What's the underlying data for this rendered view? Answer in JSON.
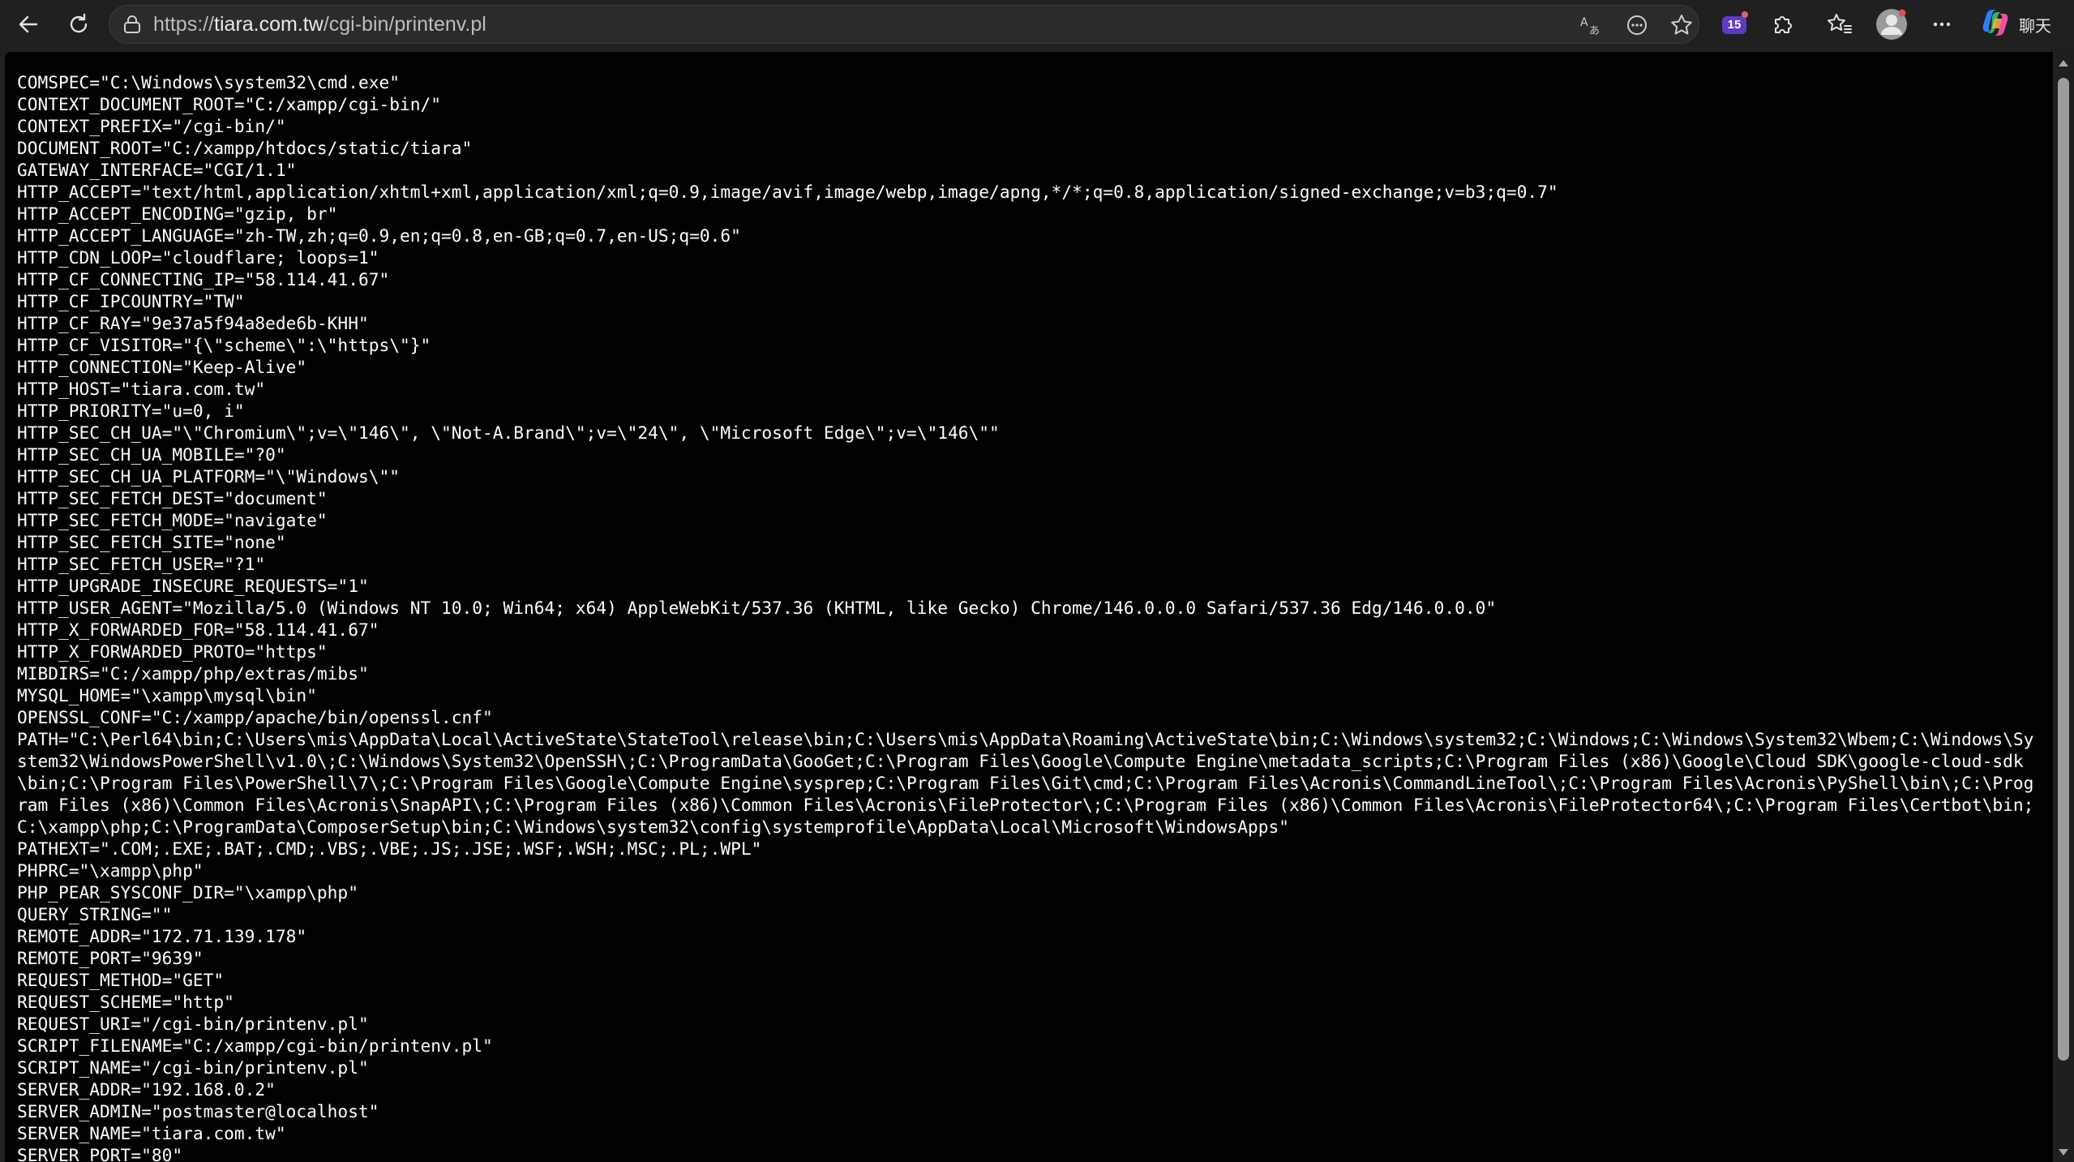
{
  "browser": {
    "url_scheme": "https://",
    "url_host": "tiara.com.tw",
    "url_path": "/cgi-bin/printenv.pl",
    "extensions_badge": "15",
    "copilot_label": "聊天",
    "icons": {
      "back": "arrow-left-icon",
      "reload": "reload-icon",
      "site_info": "lock-icon",
      "translate": "translate-icon",
      "reader": "reader-mode-icon",
      "favorite": "star-icon",
      "extensions": "puzzle-icon",
      "favorites": "favorites-icon",
      "profile": "avatar-icon",
      "more": "more-icon",
      "copilot": "copilot-icon"
    },
    "colors": {
      "toolbar_bg": "#202020",
      "page_bg": "#000000",
      "text": "#ffffff",
      "badge": "#5b3cc4"
    }
  },
  "env_lines": [
    "COMSPEC=\"C:\\Windows\\system32\\cmd.exe\"",
    "CONTEXT_DOCUMENT_ROOT=\"C:/xampp/cgi-bin/\"",
    "CONTEXT_PREFIX=\"/cgi-bin/\"",
    "DOCUMENT_ROOT=\"C:/xampp/htdocs/static/tiara\"",
    "GATEWAY_INTERFACE=\"CGI/1.1\"",
    "HTTP_ACCEPT=\"text/html,application/xhtml+xml,application/xml;q=0.9,image/avif,image/webp,image/apng,*/*;q=0.8,application/signed-exchange;v=b3;q=0.7\"",
    "HTTP_ACCEPT_ENCODING=\"gzip, br\"",
    "HTTP_ACCEPT_LANGUAGE=\"zh-TW,zh;q=0.9,en;q=0.8,en-GB;q=0.7,en-US;q=0.6\"",
    "HTTP_CDN_LOOP=\"cloudflare; loops=1\"",
    "HTTP_CF_CONNECTING_IP=\"58.114.41.67\"",
    "HTTP_CF_IPCOUNTRY=\"TW\"",
    "HTTP_CF_RAY=\"9e37a5f94a8ede6b-KHH\"",
    "HTTP_CF_VISITOR=\"{\\\"scheme\\\":\\\"https\\\"}\"",
    "HTTP_CONNECTION=\"Keep-Alive\"",
    "HTTP_HOST=\"tiara.com.tw\"",
    "HTTP_PRIORITY=\"u=0, i\"",
    "HTTP_SEC_CH_UA=\"\\\"Chromium\\\";v=\\\"146\\\", \\\"Not-A.Brand\\\";v=\\\"24\\\", \\\"Microsoft Edge\\\";v=\\\"146\\\"\"",
    "HTTP_SEC_CH_UA_MOBILE=\"?0\"",
    "HTTP_SEC_CH_UA_PLATFORM=\"\\\"Windows\\\"\"",
    "HTTP_SEC_FETCH_DEST=\"document\"",
    "HTTP_SEC_FETCH_MODE=\"navigate\"",
    "HTTP_SEC_FETCH_SITE=\"none\"",
    "HTTP_SEC_FETCH_USER=\"?1\"",
    "HTTP_UPGRADE_INSECURE_REQUESTS=\"1\"",
    "HTTP_USER_AGENT=\"Mozilla/5.0 (Windows NT 10.0; Win64; x64) AppleWebKit/537.36 (KHTML, like Gecko) Chrome/146.0.0.0 Safari/537.36 Edg/146.0.0.0\"",
    "HTTP_X_FORWARDED_FOR=\"58.114.41.67\"",
    "HTTP_X_FORWARDED_PROTO=\"https\"",
    "MIBDIRS=\"C:/xampp/php/extras/mibs\"",
    "MYSQL_HOME=\"\\xampp\\mysql\\bin\"",
    "OPENSSL_CONF=\"C:/xampp/apache/bin/openssl.cnf\"",
    "PATH=\"C:\\Perl64\\bin;C:\\Users\\mis\\AppData\\Local\\ActiveState\\StateTool\\release\\bin;C:\\Users\\mis\\AppData\\Roaming\\ActiveState\\bin;C:\\Windows\\system32;C:\\Windows;C:\\Windows\\System32\\Wbem;C:\\Windows\\System32\\WindowsPowerShell\\v1.0\\;C:\\Windows\\System32\\OpenSSH\\;C:\\ProgramData\\GooGet;C:\\Program Files\\Google\\Compute Engine\\metadata_scripts;C:\\Program Files (x86)\\Google\\Cloud SDK\\google-cloud-sdk\\bin;C:\\Program Files\\PowerShell\\7\\;C:\\Program Files\\Google\\Compute Engine\\sysprep;C:\\Program Files\\Git\\cmd;C:\\Program Files\\Acronis\\CommandLineTool\\;C:\\Program Files\\Acronis\\PyShell\\bin\\;C:\\Program Files (x86)\\Common Files\\Acronis\\SnapAPI\\;C:\\Program Files (x86)\\Common Files\\Acronis\\FileProtector\\;C:\\Program Files (x86)\\Common Files\\Acronis\\FileProtector64\\;C:\\Program Files\\Certbot\\bin;C:\\xampp\\php;C:\\ProgramData\\ComposerSetup\\bin;C:\\Windows\\system32\\config\\systemprofile\\AppData\\Local\\Microsoft\\WindowsApps\"",
    "PATHEXT=\".COM;.EXE;.BAT;.CMD;.VBS;.VBE;.JS;.JSE;.WSF;.WSH;.MSC;.PL;.WPL\"",
    "PHPRC=\"\\xampp\\php\"",
    "PHP_PEAR_SYSCONF_DIR=\"\\xampp\\php\"",
    "QUERY_STRING=\"\"",
    "REMOTE_ADDR=\"172.71.139.178\"",
    "REMOTE_PORT=\"9639\"",
    "REQUEST_METHOD=\"GET\"",
    "REQUEST_SCHEME=\"http\"",
    "REQUEST_URI=\"/cgi-bin/printenv.pl\"",
    "SCRIPT_FILENAME=\"C:/xampp/cgi-bin/printenv.pl\"",
    "SCRIPT_NAME=\"/cgi-bin/printenv.pl\"",
    "SERVER_ADDR=\"192.168.0.2\"",
    "SERVER_ADMIN=\"postmaster@localhost\"",
    "SERVER_NAME=\"tiara.com.tw\"",
    "SERVER_PORT=\"80\""
  ]
}
